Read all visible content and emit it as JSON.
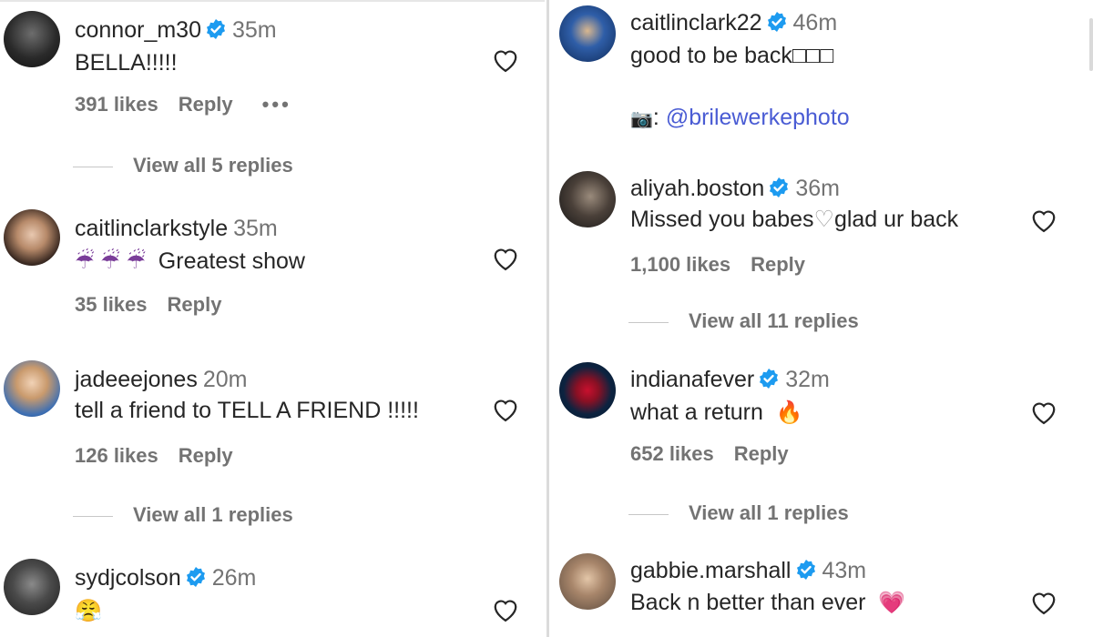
{
  "left": {
    "c1": {
      "username": "connor_m30",
      "time": "35m",
      "text": "BELLA!!!!!",
      "likes": "391 likes",
      "reply": "Reply",
      "more": "•••",
      "view_replies": "View all 5 replies"
    },
    "c2": {
      "username": "caitlinclarkstyle",
      "time": "35m",
      "emoji": "☔ ☔ ☔",
      "text": "Greatest show",
      "likes": "35 likes",
      "reply": "Reply"
    },
    "c3": {
      "username": "jadeeejones",
      "time": "20m",
      "text": "tell a friend to TELL A FRIEND !!!!!",
      "likes": "126 likes",
      "reply": "Reply",
      "view_replies": "View all 1 replies"
    },
    "c4": {
      "username": "sydjcolson",
      "time": "26m",
      "emoji": "😤"
    }
  },
  "right": {
    "c1": {
      "username": "caitlinclark22",
      "time": "46m",
      "text": "good to be back□□□",
      "camera": "📷",
      "colon": ":",
      "mention": "@brilewerkephoto"
    },
    "c2": {
      "username": "aliyah.boston",
      "time": "36m",
      "text_a": "Missed you babes",
      "heart": "♡",
      "text_b": "glad ur back",
      "likes": "1,100 likes",
      "reply": "Reply",
      "view_replies": "View all 11 replies"
    },
    "c3": {
      "username": "indianafever",
      "time": "32m",
      "text": "what a return",
      "emoji": "🔥",
      "likes": "652 likes",
      "reply": "Reply",
      "view_replies": "View all 1 replies"
    },
    "c4": {
      "username": "gabbie.marshall",
      "time": "43m",
      "text": "Back n better than ever",
      "emoji": "💗"
    }
  },
  "icons": {
    "verified": "verified-badge-icon",
    "like": "heart-outline-icon"
  },
  "colors": {
    "verified": "#1d9bf0",
    "link": "#4a5cd4",
    "secondary": "#737373"
  }
}
